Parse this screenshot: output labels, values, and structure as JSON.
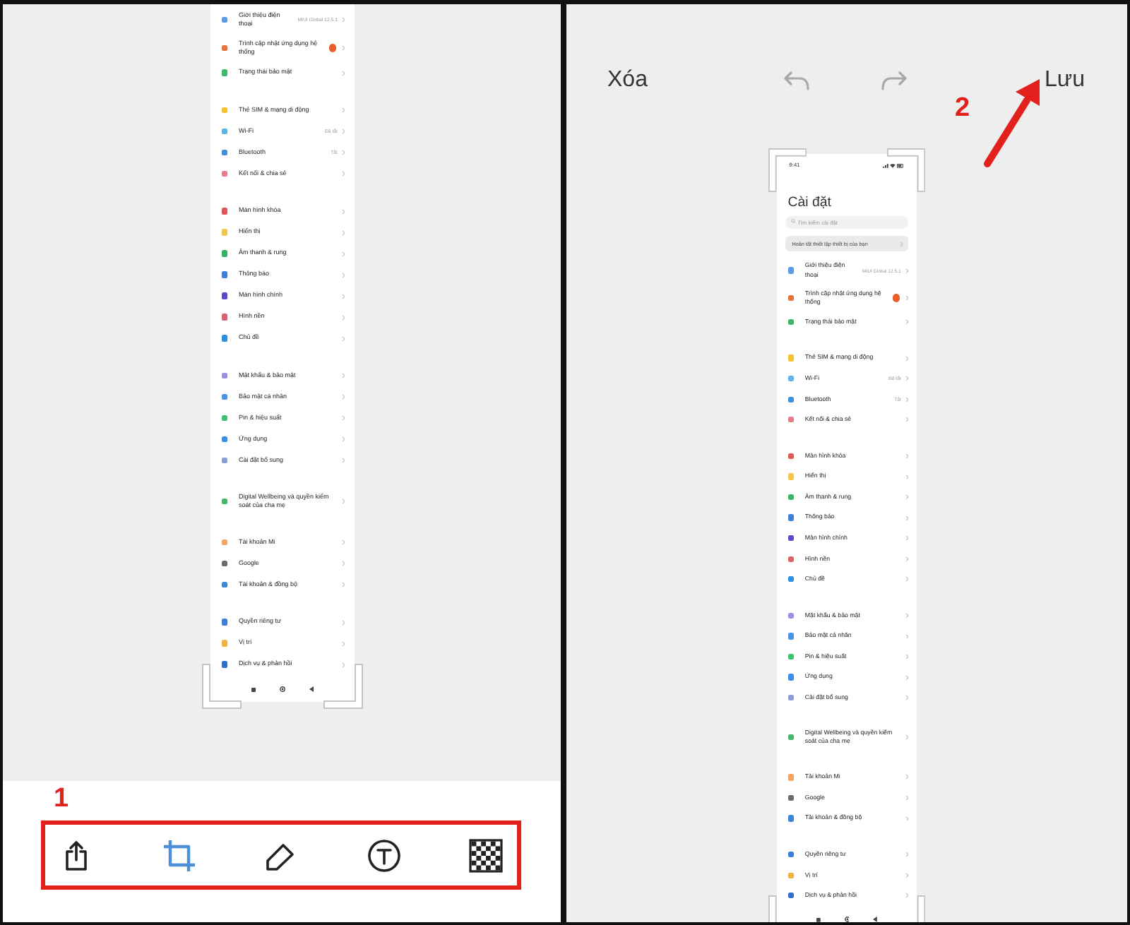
{
  "editor_left": {
    "phone_screenshot": {
      "sections": [
        {
          "items": [
            {
              "label": "Giới thiệu điện thoại",
              "color": "#5b9be8",
              "value": "MIUI Global 12.5.1",
              "update_badge": false
            },
            {
              "label": "Trình cập nhật ứng dụng hệ thống",
              "color": "#e8713a",
              "update_badge": true
            },
            {
              "label": "Trạng thái bảo mật",
              "color": "#3cb96e",
              "update_badge": false
            }
          ]
        },
        {
          "items": [
            {
              "label": "Thẻ SIM & mạng di động",
              "color": "#f2c230",
              "update_badge": false
            },
            {
              "label": "Wi-Fi",
              "color": "#5ab4ea",
              "value": "Đã tắt",
              "update_badge": false
            },
            {
              "label": "Bluetooth",
              "color": "#3b8fdc",
              "value": "Tắt",
              "update_badge": false
            },
            {
              "label": "Kết nối & chia sẻ",
              "color": "#e77b86",
              "update_badge": false
            }
          ]
        },
        {
          "items": [
            {
              "label": "Màn hình khóa",
              "color": "#e05656",
              "update_badge": false
            },
            {
              "label": "Hiển thị",
              "color": "#f3c64a",
              "update_badge": false
            },
            {
              "label": "Âm thanh & rung",
              "color": "#36b36a",
              "update_badge": false
            },
            {
              "label": "Thông báo",
              "color": "#3d7fdb",
              "update_badge": false
            },
            {
              "label": "Màn hình chính",
              "color": "#5a4cc8",
              "update_badge": false
            },
            {
              "label": "Hình nền",
              "color": "#d9606c",
              "update_badge": false
            },
            {
              "label": "Chủ đề",
              "color": "#2b8fe2",
              "update_badge": false
            }
          ]
        },
        {
          "items": [
            {
              "label": "Mật khẩu & bảo mật",
              "color": "#9c8fe2",
              "update_badge": false
            },
            {
              "label": "Bảo mật cá nhân",
              "color": "#4a93e4",
              "update_badge": false
            },
            {
              "label": "Pin & hiệu suất",
              "color": "#3cc46c",
              "update_badge": false
            },
            {
              "label": "Ứng dụng",
              "color": "#3a8ee8",
              "update_badge": false
            },
            {
              "label": "Cài đặt bổ sung",
              "color": "#8d9dd8",
              "update_badge": false
            }
          ]
        },
        {
          "items": [
            {
              "label": "Digital Wellbeing và quyền kiểm soát của cha mẹ",
              "color": "#47b56d",
              "update_badge": false
            }
          ]
        },
        {
          "items": [
            {
              "label": "Tài khoản Mi",
              "color": "#f2a65c",
              "update_badge": false
            },
            {
              "label": "Google",
              "color": "#6b6b6b",
              "update_badge": false
            },
            {
              "label": "Tài khoản & đồng bộ",
              "color": "#3a87da",
              "update_badge": false
            }
          ]
        },
        {
          "items": [
            {
              "label": "Quyền riêng tư",
              "color": "#3b80d8",
              "update_badge": false
            },
            {
              "label": "Vị trí",
              "color": "#f1b43d",
              "update_badge": false
            },
            {
              "label": "Dịch vụ & phản hồi",
              "color": "#2d6fca",
              "update_badge": false
            }
          ]
        }
      ]
    },
    "step_number": "1",
    "toolbar": [
      {
        "kind": "share",
        "selected": false
      },
      {
        "kind": "crop",
        "selected": true
      },
      {
        "kind": "draw",
        "selected": false
      },
      {
        "kind": "text",
        "selected": false
      },
      {
        "kind": "mosaic",
        "selected": false
      }
    ]
  },
  "editor_right": {
    "top_bar": {
      "delete_label": "Xóa",
      "save_label": "Lưu"
    },
    "step_number": "2",
    "phone_screenshot": {
      "status_bar": {
        "time": "9:41"
      },
      "title": "Cài đặt",
      "search": {
        "placeholder": "Tìm kiếm cài đặt"
      },
      "banner": "Hoàn tất thiết lập thiết bị của bạn",
      "sections": [
        {
          "items": [
            {
              "label": "Giới thiệu điện thoại",
              "color": "#5b9be8",
              "value": "MIUI Global 12.5.1",
              "update_badge": false
            },
            {
              "label": "Trình cập nhật ứng dụng hệ thống",
              "color": "#e8713a",
              "update_badge": true
            },
            {
              "label": "Trạng thái bảo mật",
              "color": "#3cb96e",
              "update_badge": false
            }
          ]
        },
        {
          "items": [
            {
              "label": "Thẻ SIM & mạng di động",
              "color": "#f2c230",
              "update_badge": false
            },
            {
              "label": "Wi-Fi",
              "color": "#5ab4ea",
              "value": "Đã tắt",
              "update_badge": false
            },
            {
              "label": "Bluetooth",
              "color": "#3b8fdc",
              "value": "Tắt",
              "update_badge": false
            },
            {
              "label": "Kết nối & chia sẻ",
              "color": "#e77b86",
              "update_badge": false
            }
          ]
        },
        {
          "items": [
            {
              "label": "Màn hình khóa",
              "color": "#e05656",
              "update_badge": false
            },
            {
              "label": "Hiển thị",
              "color": "#f3c64a",
              "update_badge": false
            },
            {
              "label": "Âm thanh & rung",
              "color": "#36b36a",
              "update_badge": false
            },
            {
              "label": "Thông báo",
              "color": "#3d7fdb",
              "update_badge": false
            },
            {
              "label": "Màn hình chính",
              "color": "#5a4cc8",
              "update_badge": false
            },
            {
              "label": "Hình nền",
              "color": "#d9606c",
              "update_badge": false
            },
            {
              "label": "Chủ đề",
              "color": "#2b8fe2",
              "update_badge": false
            }
          ]
        },
        {
          "items": [
            {
              "label": "Mật khẩu & bảo mật",
              "color": "#9c8fe2",
              "update_badge": false
            },
            {
              "label": "Bảo mật cá nhân",
              "color": "#4a93e4",
              "update_badge": false
            },
            {
              "label": "Pin & hiệu suất",
              "color": "#3cc46c",
              "update_badge": false
            },
            {
              "label": "Ứng dụng",
              "color": "#3a8ee8",
              "update_badge": false
            },
            {
              "label": "Cài đặt bổ sung",
              "color": "#8d9dd8",
              "update_badge": false
            }
          ]
        },
        {
          "items": [
            {
              "label": "Digital Wellbeing và quyền kiểm soát của cha mẹ",
              "color": "#47b56d",
              "update_badge": false
            }
          ]
        },
        {
          "items": [
            {
              "label": "Tài khoản Mi",
              "color": "#f2a65c",
              "update_badge": false
            },
            {
              "label": "Google",
              "color": "#6b6b6b",
              "update_badge": false
            },
            {
              "label": "Tài khoản & đồng bộ",
              "color": "#3a87da",
              "update_badge": false
            }
          ]
        },
        {
          "items": [
            {
              "label": "Quyền riêng tư",
              "color": "#3b80d8",
              "update_badge": false
            },
            {
              "label": "Vị trí",
              "color": "#f1b43d",
              "update_badge": false
            },
            {
              "label": "Dịch vụ & phản hồi",
              "color": "#2d6fca",
              "update_badge": false
            }
          ]
        }
      ]
    }
  }
}
